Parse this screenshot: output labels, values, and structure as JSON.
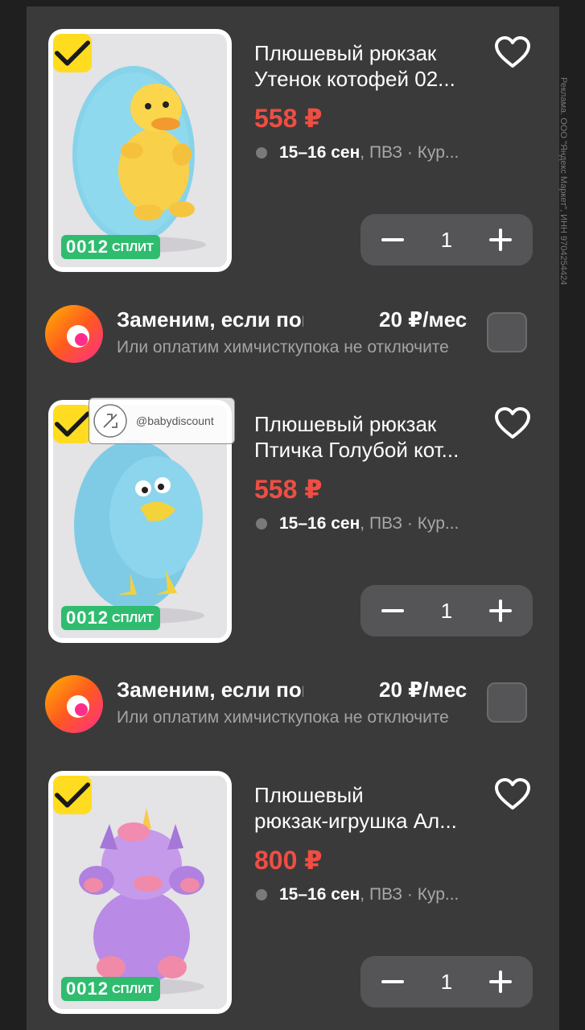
{
  "ad_note": "Реклама. ООО \"Яндекс Маркет\", ИНН 9704254424",
  "products": [
    {
      "title_line1": "Плюшевый рюкзак",
      "title_line2": "Утенок котофей 02...",
      "price": "558 ₽",
      "date": "15–16 сен",
      "place": ", ПВЗ · Кур...",
      "split_number": "0012",
      "split_label": "СПЛИТ",
      "quantity": "1",
      "toy": "duck"
    },
    {
      "title_line1": "Плюшевый рюкзак",
      "title_line2": "Птичка Голубой кот...",
      "price": "558 ₽",
      "date": "15–16 сен",
      "place": ", ПВЗ · Кур...",
      "split_number": "0012",
      "split_label": "СПЛИТ",
      "quantity": "1",
      "toy": "bird"
    },
    {
      "title_line1": "Плюшевый",
      "title_line2": "рюкзак-игрушка Ал...",
      "price": "800 ₽",
      "date": "15–16 сен",
      "place": ", ПВЗ · Кур...",
      "split_number": "0012",
      "split_label": "СПЛИТ",
      "quantity": "1",
      "toy": "unicorn"
    }
  ],
  "insurance": [
    {
      "title": "Заменим, если повредится",
      "price": "20 ₽/мес",
      "sub_a": "Или оплатим химчистку",
      "sub_b": "пока не отключите"
    },
    {
      "title": "Заменим, если повредится",
      "price": "20 ₽/мес",
      "sub_a": "Или оплатим химчистку",
      "sub_b": "пока не отключите"
    }
  ],
  "watermark": "@babydiscount",
  "colors": {
    "price": "#ef4e43",
    "split": "#2fbc6f",
    "check": "#ffdc1f"
  }
}
